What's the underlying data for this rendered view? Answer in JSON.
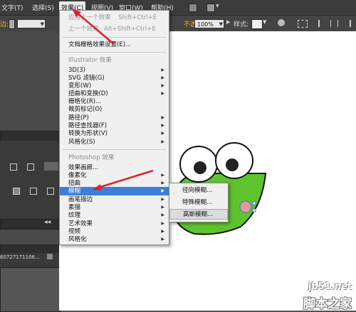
{
  "menubar": {
    "items": [
      {
        "label": "文字(T)"
      },
      {
        "label": "选择(S)"
      },
      {
        "label": "效果(C)"
      },
      {
        "label": "视图(V)"
      },
      {
        "label": "窗口(W)"
      },
      {
        "label": "帮助(H)"
      }
    ]
  },
  "controlbar": {
    "left_label": "边:",
    "opacity_label": "不透明度:",
    "opacity_value": "100%",
    "style_label": "样式:"
  },
  "effect_menu": {
    "apply_last": {
      "label": "应用上一个效果",
      "shortcut": "Shift+Ctrl+E"
    },
    "last_effect": {
      "label": "上一个效果",
      "shortcut": "Alt+Shift+Ctrl+E"
    },
    "raster_settings": "文档栅格效果设置(E)...",
    "illustrator_header": "Illustrator 效果",
    "illustrator_items": [
      "3D(3)",
      "SVG 滤镜(G)",
      "变形(W)",
      "扭曲和变换(D)",
      "栅格化(R)...",
      "裁剪标记(O)",
      "路径(P)",
      "路径查找器(F)",
      "转换为形状(V)",
      "风格化(S)"
    ],
    "photoshop_header": "Photoshop 效果",
    "photoshop_items": [
      "效果画廊...",
      "像素化",
      "扭曲",
      "模糊",
      "画笔描边",
      "素描",
      "纹理",
      "艺术效果",
      "视频",
      "风格化"
    ]
  },
  "blur_submenu": {
    "items": [
      "径向模糊...",
      "特殊模糊...",
      "高斯模糊..."
    ],
    "highlighted": "高斯模糊..."
  },
  "left_panel": {
    "file_label": "60727171106..."
  },
  "colors": {
    "frog_green": "#5ec42e",
    "menu_highlight": "#3d7fd6",
    "arrow_red": "#e0202a",
    "cheek_pink": "#e29a9a"
  },
  "watermark": {
    "url": "jb51.net",
    "cn": "脚本之家"
  }
}
